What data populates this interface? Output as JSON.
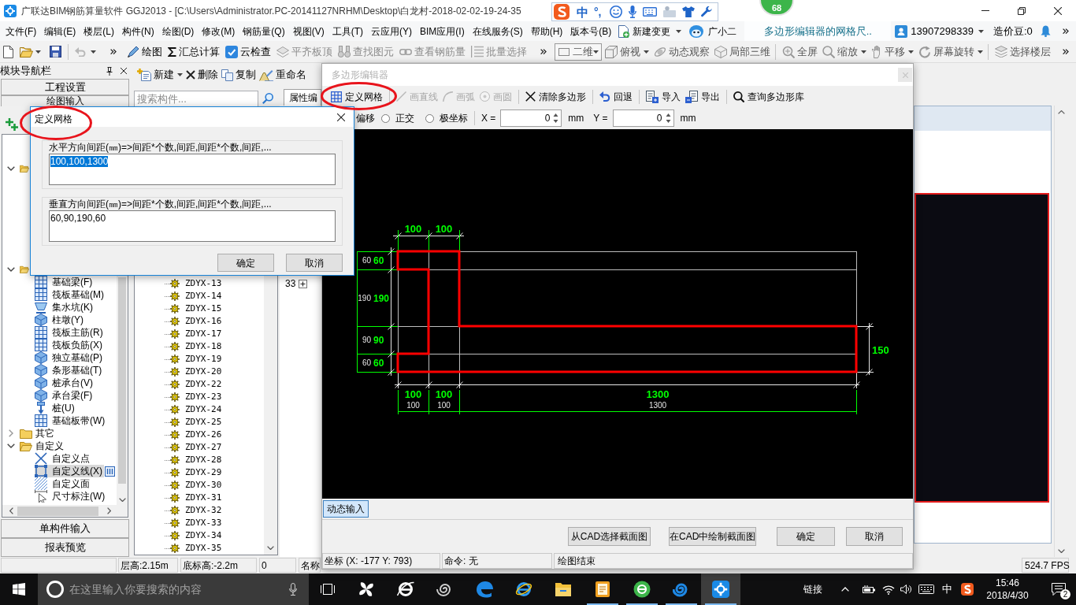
{
  "window": {
    "title": "广联达BIM钢筋算量软件 GGJ2013 - [C:\\Users\\Administrator.PC-20141127NRHM\\Desktop\\白龙村-2018-02-02-19-24-35"
  },
  "ime_bar": {
    "mode": "中",
    "punctuation": "°,"
  },
  "score_badge": "68",
  "menu": [
    "文件(F)",
    "编辑(E)",
    "楼层(L)",
    "构件(N)",
    "绘图(D)",
    "修改(M)",
    "钢筋量(Q)",
    "视图(V)",
    "工具(T)",
    "云应用(Y)",
    "BIM应用(I)",
    "在线服务(S)",
    "帮助(H)",
    "版本号(B)"
  ],
  "change_menu": "新建变更",
  "assistant": "广小二",
  "document_tab": "多边形编辑器的网格尺..",
  "account": {
    "phone": "13907298339",
    "coins": "造价豆:0"
  },
  "quick_access": [
    {
      "kind": "new",
      "disabled": false
    },
    {
      "kind": "open",
      "disabled": false
    },
    {
      "kind": "save",
      "disabled": false
    },
    {
      "kind": "undo",
      "disabled": true
    }
  ],
  "toolbar": [
    {
      "label": "绘图",
      "disabled": false
    },
    {
      "label": "汇总计算",
      "disabled": false
    },
    {
      "label": "云检查",
      "disabled": false
    },
    {
      "label": "平齐板顶",
      "disabled": true
    },
    {
      "label": "查找图元",
      "disabled": true
    },
    {
      "label": "查看钢筋量",
      "disabled": true
    },
    {
      "label": "批量选择",
      "disabled": true
    }
  ],
  "view_toolbar": [
    {
      "label": "二维",
      "kind": "combo"
    },
    {
      "label": "俯视",
      "kind": "dropdown"
    },
    {
      "label": "动态观察",
      "kind": "button"
    },
    {
      "label": "局部三维",
      "kind": "button"
    },
    {
      "label": "全屏",
      "kind": "button"
    },
    {
      "label": "缩放",
      "kind": "dropdown"
    },
    {
      "label": "平移",
      "kind": "dropdown"
    },
    {
      "label": "屏幕旋转",
      "kind": "dropdown"
    },
    {
      "label": "选择楼层",
      "kind": "button"
    }
  ],
  "navigator": {
    "title": "模块导航栏",
    "sections": [
      "工程设置",
      "绘图输入"
    ],
    "tree": [
      {
        "expanded": true
      },
      {
        "expanded": true,
        "children": [
          {
            "label": "基础梁(F)",
            "selected": false
          },
          {
            "label": "筏板基础(M)",
            "selected": false
          },
          {
            "label": "集水坑(K)",
            "selected": false
          },
          {
            "label": "柱墩(Y)",
            "selected": false
          },
          {
            "label": "筏板主筋(R)",
            "selected": false
          },
          {
            "label": "筏板负筋(X)",
            "selected": false
          },
          {
            "label": "独立基础(P)",
            "selected": false
          },
          {
            "label": "条形基础(T)",
            "selected": false
          },
          {
            "label": "桩承台(V)",
            "selected": false
          },
          {
            "label": "承台梁(F)",
            "selected": false
          },
          {
            "label": "桩(U)",
            "selected": false
          },
          {
            "label": "基础板带(W)",
            "selected": false
          }
        ]
      },
      {
        "label": "其它",
        "expanded": false,
        "selected": false
      },
      {
        "label": "自定义",
        "expanded": true,
        "selected": false,
        "children": [
          {
            "label": "自定义点",
            "selected": false
          },
          {
            "label": "自定义线(X)",
            "selected": true
          },
          {
            "label": "自定义面",
            "selected": false
          },
          {
            "label": "尺寸标注(W)",
            "selected": false
          }
        ]
      }
    ],
    "footer": [
      "单构件输入",
      "报表预览"
    ]
  },
  "components": {
    "toolbar": [
      {
        "label": "新建",
        "dropdown": true
      },
      {
        "label": "删除",
        "dropdown": false
      },
      {
        "label": "复制",
        "dropdown": false
      },
      {
        "label": "重命名",
        "dropdown": false
      }
    ],
    "search": {
      "placeholder": "搜索构件..."
    },
    "items": [
      {
        "label": "ZDYX-13",
        "selected": false
      },
      {
        "label": "ZDYX-14",
        "selected": false
      },
      {
        "label": "ZDYX-15",
        "selected": false
      },
      {
        "label": "ZDYX-16",
        "selected": false
      },
      {
        "label": "ZDYX-17",
        "selected": false
      },
      {
        "label": "ZDYX-18",
        "selected": false
      },
      {
        "label": "ZDYX-19",
        "selected": false
      },
      {
        "label": "ZDYX-20",
        "selected": false
      },
      {
        "label": "ZDYX-22",
        "selected": false
      },
      {
        "label": "ZDYX-23",
        "selected": false
      },
      {
        "label": "ZDYX-24",
        "selected": false
      },
      {
        "label": "ZDYX-25",
        "selected": false
      },
      {
        "label": "ZDYX-26",
        "selected": false
      },
      {
        "label": "ZDYX-27",
        "selected": false
      },
      {
        "label": "ZDYX-28",
        "selected": false
      },
      {
        "label": "ZDYX-29",
        "selected": false
      },
      {
        "label": "ZDYX-30",
        "selected": false
      },
      {
        "label": "ZDYX-31",
        "selected": false
      },
      {
        "label": "ZDYX-32",
        "selected": false
      },
      {
        "label": "ZDYX-33",
        "selected": false
      },
      {
        "label": "ZDYX-34",
        "selected": false
      },
      {
        "label": "ZDYX-35",
        "selected": false
      }
    ]
  },
  "properties": {
    "tabs": [
      {
        "label": "属性编",
        "selected": true
      }
    ],
    "rows": [
      "33"
    ]
  },
  "polygon_editor": {
    "title": "多边形编辑器",
    "active": false,
    "tools": [
      {
        "label": "定义网格",
        "disabled": false
      },
      {
        "label": "画直线",
        "disabled": true
      },
      {
        "label": "画弧",
        "disabled": true
      },
      {
        "label": "画圆",
        "disabled": true
      },
      {
        "label": "清除多边形",
        "disabled": false
      },
      {
        "label": "回退",
        "disabled": false
      },
      {
        "label": "导入",
        "disabled": false
      },
      {
        "label": "导出",
        "disabled": false
      },
      {
        "label": "查询多边形库",
        "disabled": false
      }
    ],
    "offset_label": "偏移",
    "snap_modes": [
      {
        "label": "正交",
        "selected": false
      },
      {
        "label": "极坐标",
        "selected": false
      }
    ],
    "coordinates": [
      {
        "label": "X =",
        "value": "0",
        "unit": "mm"
      },
      {
        "label": "Y =",
        "value": "0",
        "unit": "mm"
      }
    ],
    "canvas": {
      "top_dimensions": [
        "100",
        "100"
      ],
      "grid_columns": [
        {
          "grid_label": "100",
          "dimension_label": "100"
        },
        {
          "grid_label": "100",
          "dimension_label": "100"
        },
        {
          "grid_label": "1300",
          "dimension_label": "1300"
        }
      ],
      "grid_rows": [
        {
          "grid_label": "60",
          "dimension_label": "60"
        },
        {
          "grid_label": "190",
          "dimension_label": "190"
        },
        {
          "grid_label": "90",
          "dimension_label": "90"
        },
        {
          "grid_label": "60",
          "dimension_label": "60"
        }
      ],
      "right_dimension": "150"
    },
    "dynamic_input": {
      "label": "动态输入",
      "on": true
    },
    "buttons": [
      "从CAD选择截面图",
      "在CAD中绘制截面图",
      "确定",
      "取消"
    ],
    "status": {
      "coordinates": "坐标 (X: -177 Y: 793)",
      "command": "命令: 无",
      "message": "绘图结束"
    }
  },
  "grid_dialog": {
    "title": "定义网格",
    "fields": [
      {
        "label": "水平方向间距(㎜)=>间距*个数,间距,间距*个数,间距,...",
        "value": "100,100,1300",
        "text_selected": true
      },
      {
        "label": "垂直方向间距(㎜)=>间距*个数,间距,间距*个数,间距,...",
        "value": "60,90,190,60",
        "text_selected": false
      }
    ],
    "buttons": [
      "确定",
      "取消"
    ]
  },
  "status_bar": {
    "cells": [
      "层高:2.15m",
      "底标高:-2.2m",
      "0",
      "名称"
    ],
    "fps": "524.7 FPS"
  },
  "taskbar": {
    "search_placeholder": "在这里输入你要搜索的内容",
    "apps": [
      {
        "running": false,
        "selected": false
      },
      {
        "running": false,
        "selected": false
      },
      {
        "running": false,
        "selected": false
      },
      {
        "running": false,
        "selected": false
      },
      {
        "running": false,
        "selected": false
      },
      {
        "running": false,
        "selected": false
      },
      {
        "running": true,
        "selected": false
      },
      {
        "running": true,
        "selected": false
      },
      {
        "running": true,
        "selected": false
      },
      {
        "running": true,
        "selected": true
      }
    ],
    "links": "链接",
    "ime": "中",
    "time": "15:46",
    "date": "2018/4/30",
    "notifications": "2"
  }
}
